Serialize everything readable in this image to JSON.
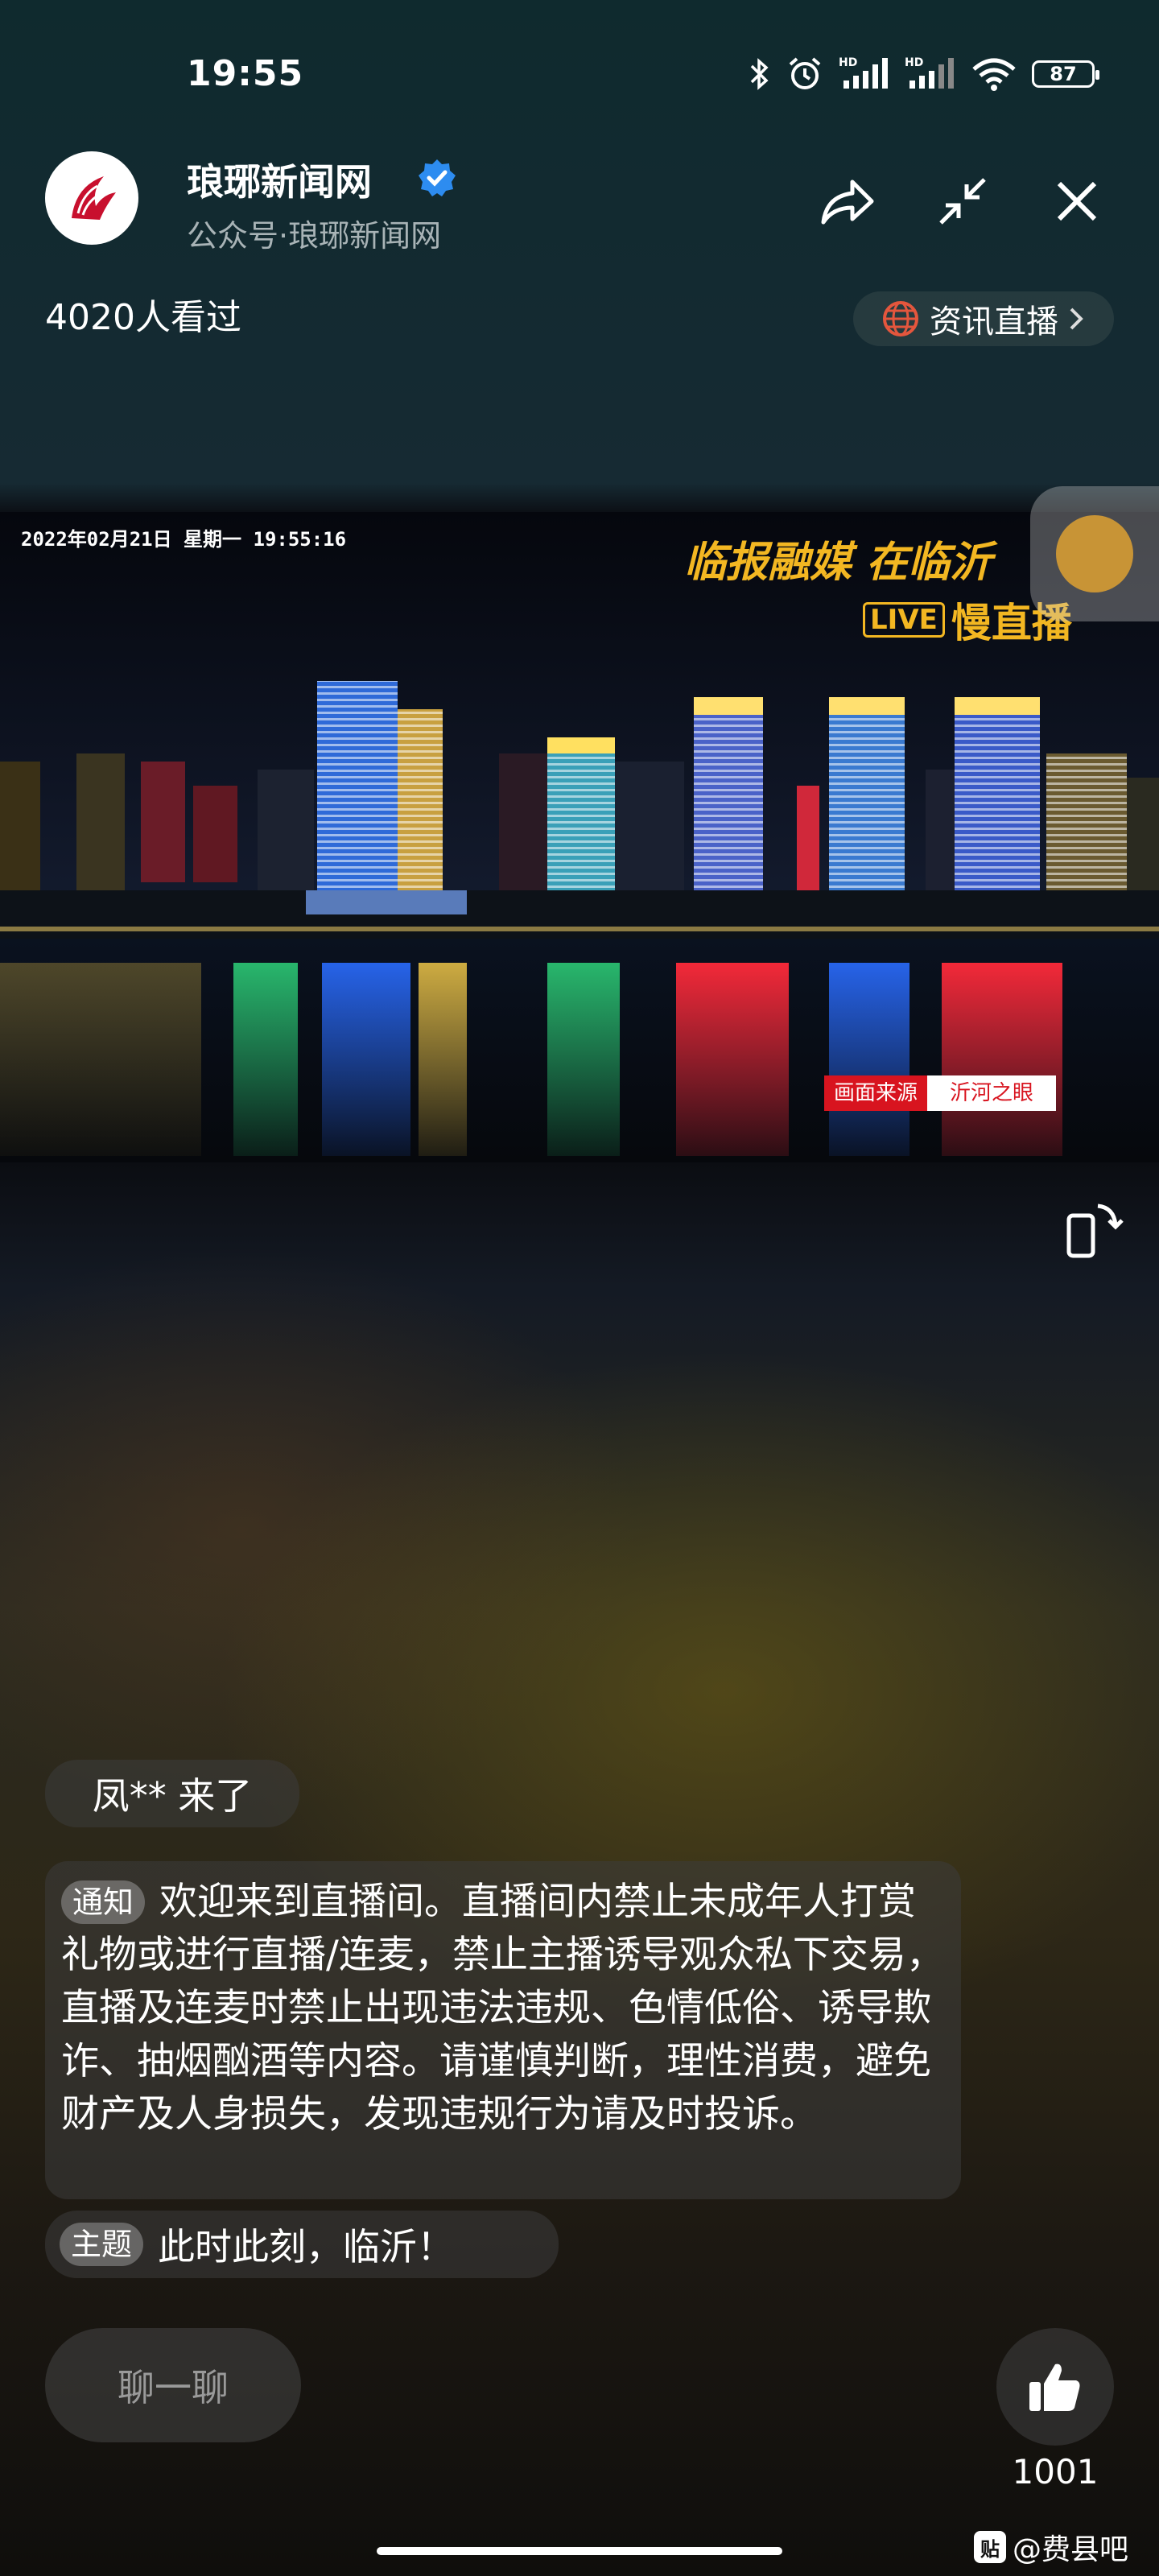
{
  "status_bar": {
    "time": "19:55",
    "battery": "87"
  },
  "header": {
    "account_name": "琅琊新闻网",
    "account_sub": "公众号·琅琊新闻网",
    "views": "4020人看过",
    "news_pill": "资讯直播"
  },
  "video": {
    "timestamp": "2022年02月21日  星期一  19:55:16",
    "brand_line1": "临报融媒  在临沂",
    "live_badge": "LIVE",
    "brand_line2": "慢直播",
    "source_label": "画面来源",
    "source_name": "沂河之眼"
  },
  "chat": {
    "join_message": "凤** 来了",
    "notice_tag": "通知",
    "notice_text": "欢迎来到直播间。直播间内禁止未成年人打赏礼物或进行直播/连麦，禁止主播诱导观众私下交易，直播及连麦时禁止出现违法违规、色情低俗、诱导欺诈、抽烟酗酒等内容。请谨慎判断，理性消费，避免财产及人身损失，发现违规行为请及时投诉。",
    "topic_tag": "主题",
    "topic_text": "此时此刻，临沂！"
  },
  "footer": {
    "chat_button": "聊一聊",
    "like_count": "1001",
    "watermark": "@费县吧",
    "watermark_icon": "贴"
  },
  "colors": {
    "brand_gold": "#f3b722",
    "source_red": "#d8141f"
  }
}
